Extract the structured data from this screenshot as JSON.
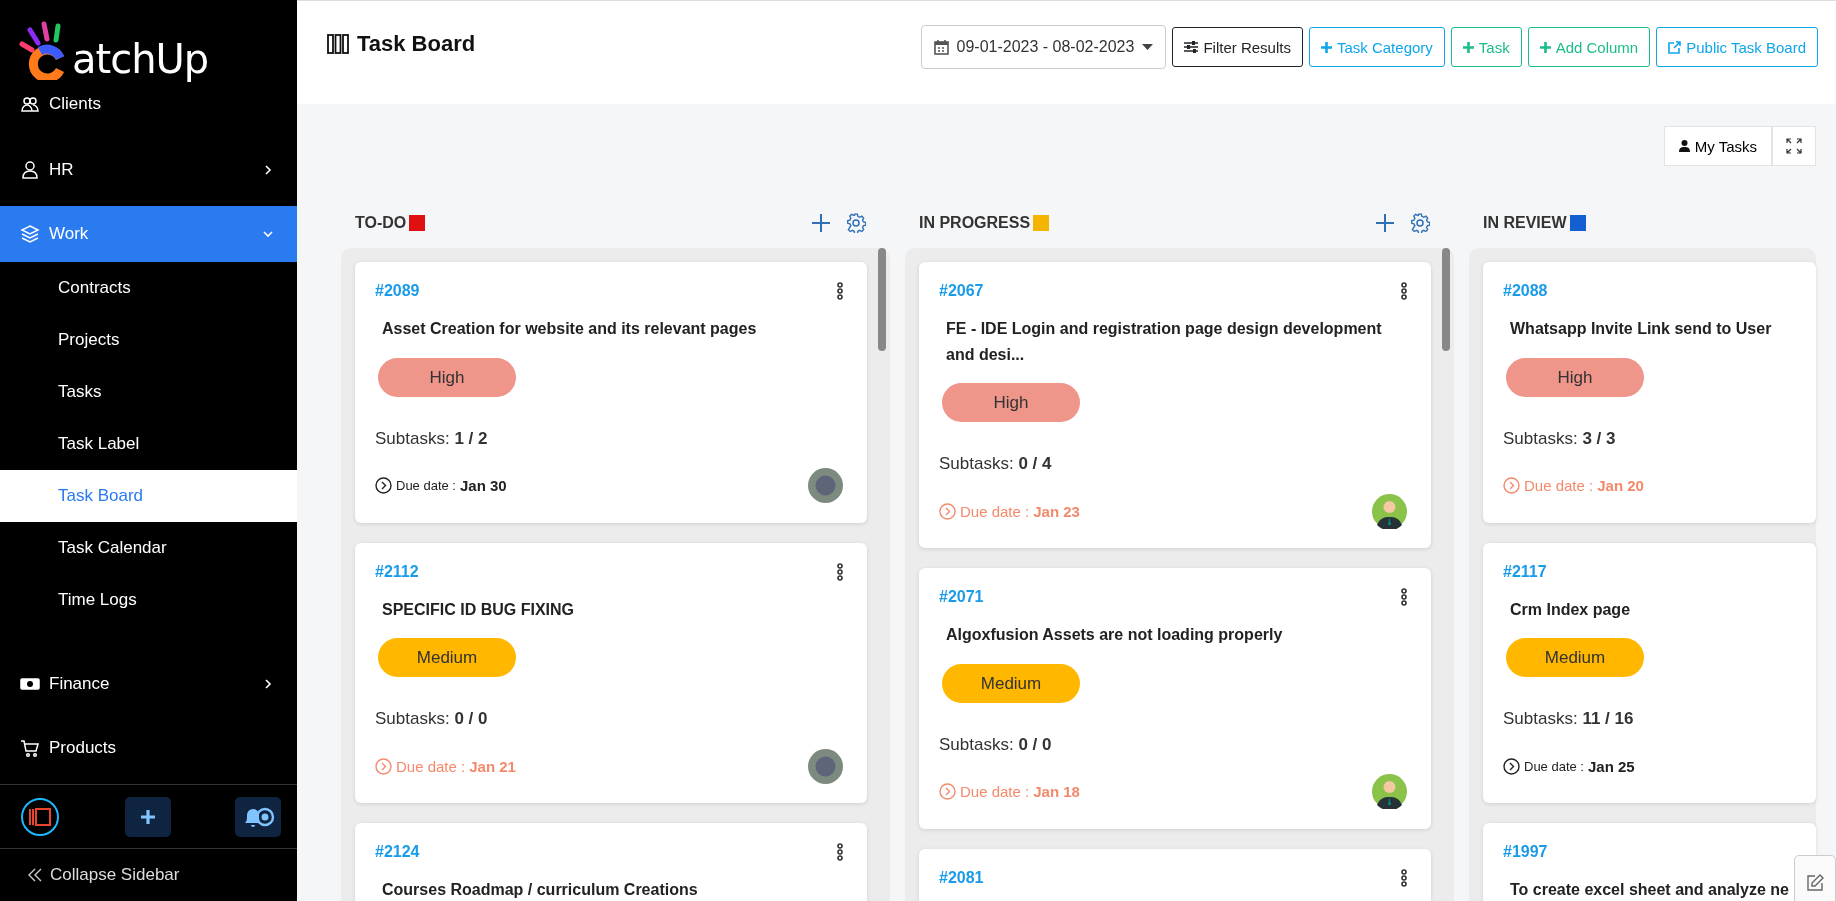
{
  "sidebar": {
    "logo": {
      "text": "atchUp"
    },
    "items": [
      {
        "label": "Clients",
        "selected": false
      },
      {
        "label": "HR",
        "selected": false,
        "expanded": false
      },
      {
        "label": "Work",
        "selected": true,
        "expanded": true,
        "children": [
          {
            "label": "Contracts",
            "selected": false
          },
          {
            "label": "Projects",
            "selected": false
          },
          {
            "label": "Tasks",
            "selected": false
          },
          {
            "label": "Task Label",
            "selected": false
          },
          {
            "label": "Task Board",
            "selected": true
          },
          {
            "label": "Task Calendar",
            "selected": false
          },
          {
            "label": "Time Logs",
            "selected": false
          }
        ]
      },
      {
        "label": "Finance",
        "selected": false,
        "expanded": false
      },
      {
        "label": "Products",
        "selected": false
      }
    ],
    "collapse": "Collapse Sidebar"
  },
  "header": {
    "title": "Task Board",
    "date_range": "09-01-2023 - 08-02-2023",
    "buttons": [
      {
        "label": "Filter Results",
        "color": "#212529"
      },
      {
        "label": "Task Category",
        "color": "#0ea5e9"
      },
      {
        "label": "Task",
        "color": "#1cbb8c"
      },
      {
        "label": "Add Column",
        "color": "#1cbb8c"
      },
      {
        "label": "Public Task Board",
        "color": "#0ea5e9"
      }
    ]
  },
  "toolbar": {
    "my_tasks": "My Tasks"
  },
  "columns": [
    {
      "title": "TO-DO",
      "color": "#e01010",
      "actions_visible": true,
      "scrollbar": true,
      "cards": [
        {
          "id": "#2089",
          "title": "Asset Creation for website and its relevant pages",
          "badge": {
            "label": "High",
            "color": "#f0958a"
          },
          "subtasks_label": "Subtasks:",
          "subtasks": "1 / 2",
          "due_label": "Due date :",
          "due": "Jan 30",
          "overdue": false,
          "avatar_photo": true
        },
        {
          "id": "#2112",
          "title": "SPECIFIC ID BUG FIXING",
          "badge": {
            "label": "Medium",
            "color": "#ffb700"
          },
          "subtasks_label": "Subtasks:",
          "subtasks": "0 / 0",
          "due_label": "Due date :",
          "due": "Jan 21",
          "overdue": true,
          "avatar_photo": true
        },
        {
          "id": "#2124",
          "title": "Courses Roadmap / curriculum Creations"
        }
      ]
    },
    {
      "title": "IN PROGRESS",
      "color": "#f5b400",
      "actions_visible": true,
      "scrollbar": true,
      "cards": [
        {
          "id": "#2067",
          "title": "FE - IDE Login and registration page design development and desi...",
          "badge": {
            "label": "High",
            "color": "#f0958a"
          },
          "subtasks_label": "Subtasks:",
          "subtasks": "0 / 4",
          "due_label": "Due date :",
          "due": "Jan 23",
          "overdue": true,
          "avatar_photo": false
        },
        {
          "id": "#2071",
          "title": "Algoxfusion Assets are not loading properly",
          "badge": {
            "label": "Medium",
            "color": "#ffb700"
          },
          "subtasks_label": "Subtasks:",
          "subtasks": "0 / 0",
          "due_label": "Due date :",
          "due": "Jan 18",
          "overdue": true,
          "avatar_photo": false
        },
        {
          "id": "#2081"
        }
      ]
    },
    {
      "title": "IN REVIEW",
      "color": "#1560d0",
      "actions_visible": false,
      "scrollbar": false,
      "cards": [
        {
          "id": "#2088",
          "title": "Whatsapp Invite Link send to User",
          "badge": {
            "label": "High",
            "color": "#f0958a"
          },
          "subtasks_label": "Subtasks:",
          "subtasks": "3 / 3",
          "due_label": "Due date :",
          "due": "Jan 20",
          "overdue": true
        },
        {
          "id": "#2117",
          "title": "Crm Index page",
          "badge": {
            "label": "Medium",
            "color": "#ffb700"
          },
          "subtasks_label": "Subtasks:",
          "subtasks": "11 / 16",
          "due_label": "Due date :",
          "due": "Jan 25",
          "overdue": false
        },
        {
          "id": "#1997",
          "title": "To create excel sheet and analyze ne"
        }
      ]
    }
  ]
}
